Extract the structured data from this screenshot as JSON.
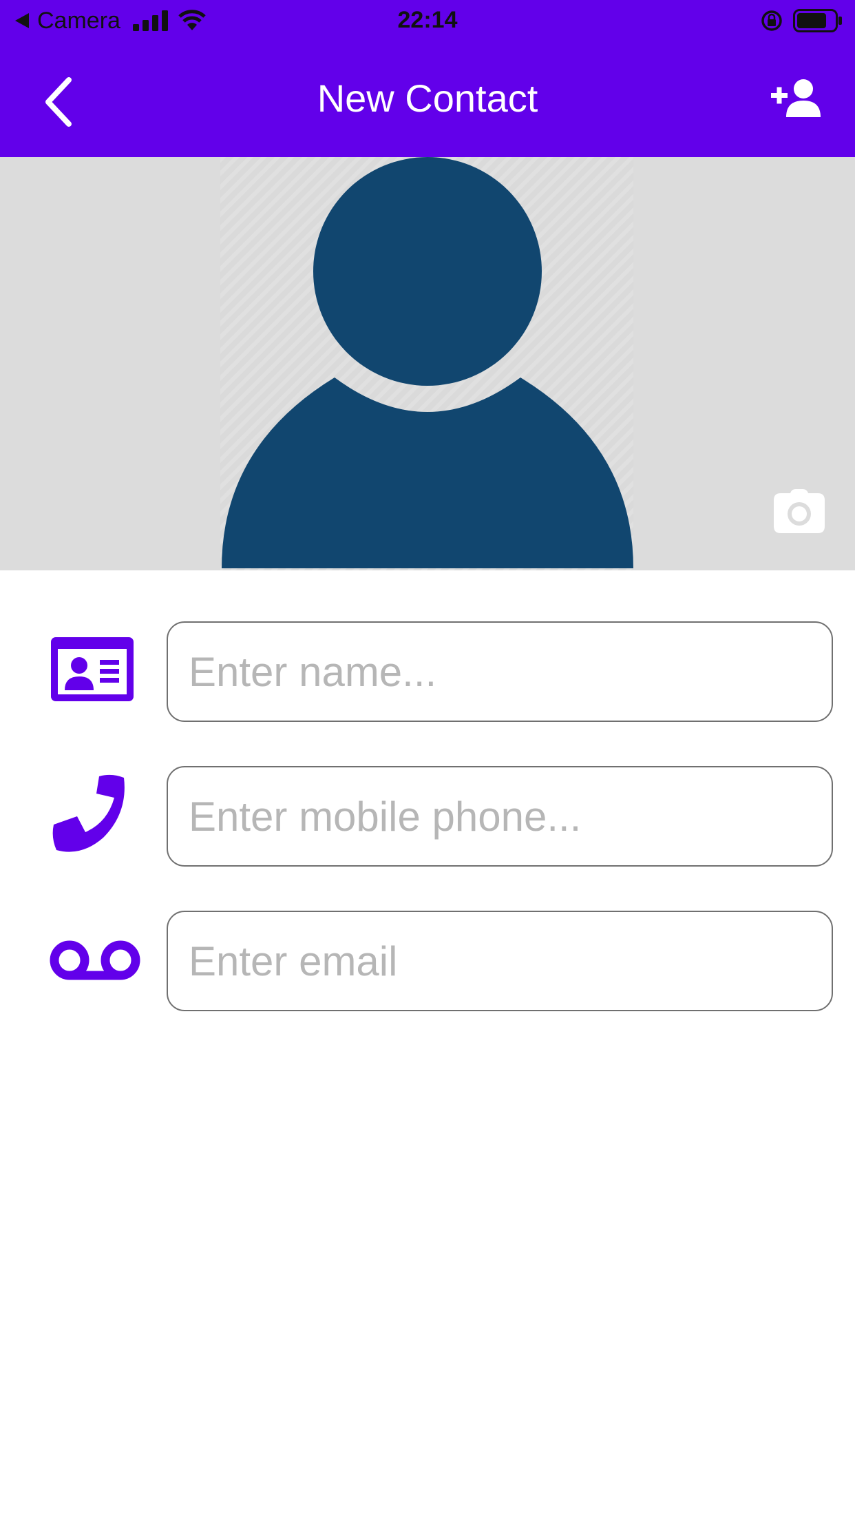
{
  "status_bar": {
    "back_app": "Camera",
    "time": "22:14"
  },
  "header": {
    "title": "New Contact",
    "back_icon": "chevron-left-icon",
    "action_icon": "add-user-icon"
  },
  "photo": {
    "avatar_icon": "person-silhouette-icon",
    "camera_icon": "camera-icon"
  },
  "form": {
    "fields": [
      {
        "icon": "id-card-icon",
        "placeholder": "Enter name...",
        "value": ""
      },
      {
        "icon": "phone-icon",
        "placeholder": "Enter mobile phone...",
        "value": ""
      },
      {
        "icon": "voicemail-icon",
        "placeholder": "Enter email",
        "value": ""
      }
    ]
  },
  "colors": {
    "accent": "#6200EA",
    "avatar": "#11466F",
    "photo_background": "#DCDCDC",
    "placeholder": "#B6B6B6"
  }
}
